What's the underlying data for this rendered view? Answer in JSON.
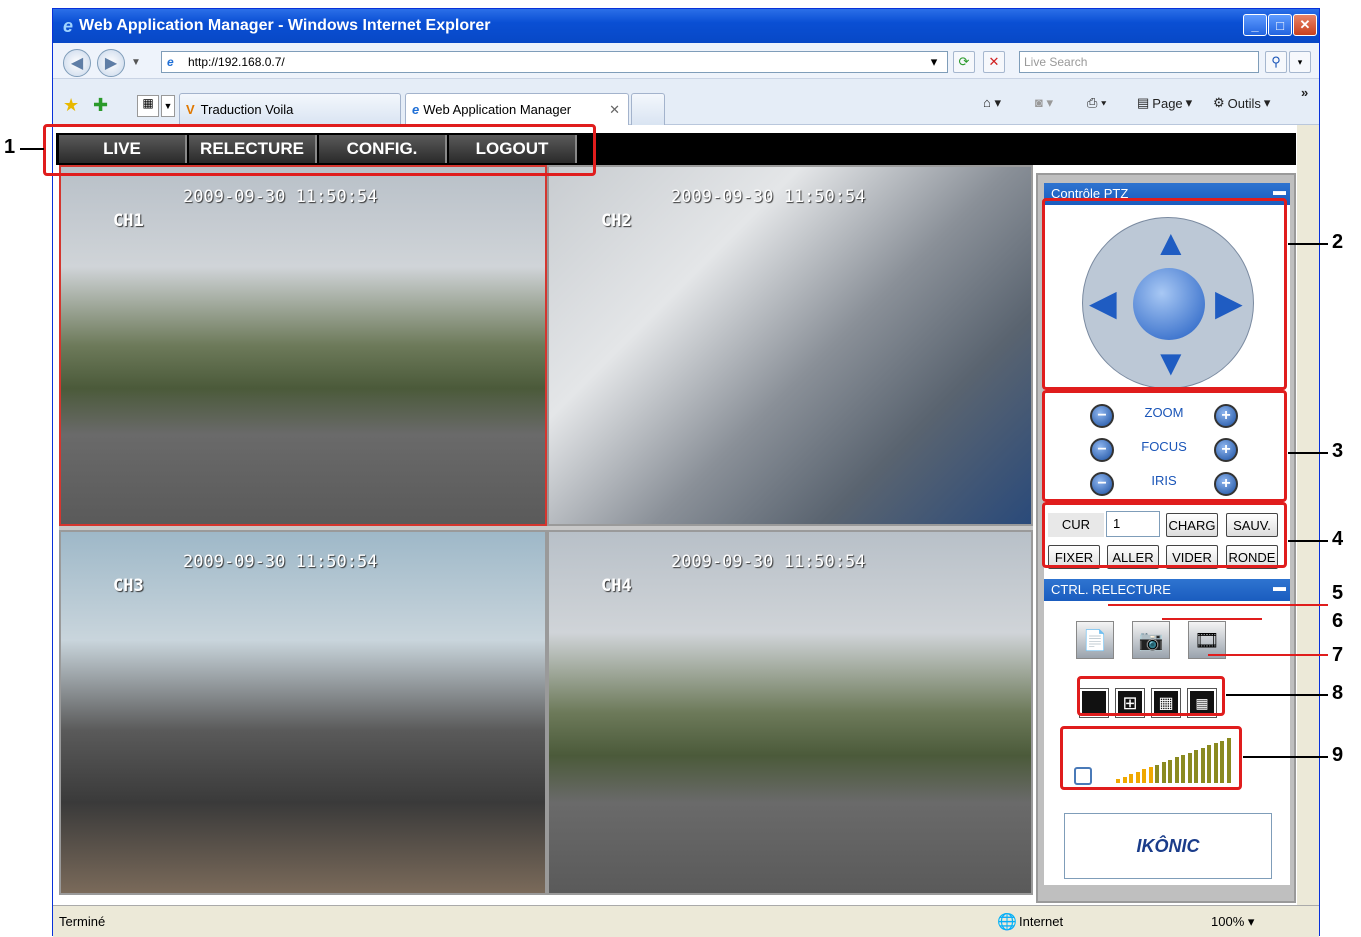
{
  "window": {
    "title": "Web Application Manager - Windows Internet Explorer"
  },
  "address": {
    "url": "http://192.168.0.7/",
    "search_placeholder": "Live Search"
  },
  "tabs": [
    {
      "label": "Traduction Voila"
    },
    {
      "label": "Web Application Manager"
    }
  ],
  "toolbar": {
    "page": "Page",
    "tools": "Outils"
  },
  "menu": [
    "LIVE",
    "RELECTURE",
    "CONFIG.",
    "LOGOUT"
  ],
  "cameras": [
    {
      "label": "CH1",
      "timestamp": "2009-09-30 11:50:54"
    },
    {
      "label": "CH2",
      "timestamp": "2009-09-30 11:50:54"
    },
    {
      "label": "CH3",
      "timestamp": "2009-09-30 11:50:54"
    },
    {
      "label": "CH4",
      "timestamp": "2009-09-30 11:50:54"
    }
  ],
  "ptz": {
    "title": "Contrôle PTZ",
    "zoom": "ZOOM",
    "focus": "FOCUS",
    "iris": "IRIS",
    "cur_label": "CUR",
    "cur_value": "1",
    "charg": "CHARG",
    "sauv": "SAUV.",
    "fixer": "FIXER",
    "aller": "ALLER",
    "vider": "VIDER",
    "ronde": "RONDE"
  },
  "playback": {
    "title": "CTRL. RELECTURE"
  },
  "logo": "IKÔNIC",
  "status": {
    "text": "Terminé",
    "zone": "Internet",
    "zoom": "100%"
  },
  "annotations": [
    "1",
    "2",
    "3",
    "4",
    "5",
    "6",
    "7",
    "8",
    "9"
  ],
  "colors": {
    "menubar": "#000000",
    "panel_header": "#1a5cbf",
    "annotation": "#e01d1d"
  }
}
